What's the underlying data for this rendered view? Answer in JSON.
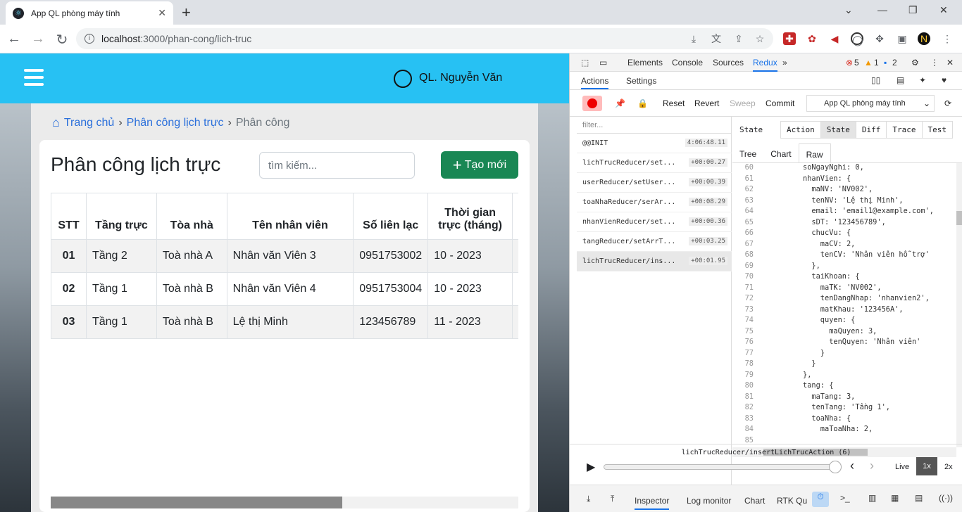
{
  "browser": {
    "tab_title": "App QL phòng máy tính",
    "url_host": "localhost",
    "url_path": ":3000/phan-cong/lich-truc"
  },
  "header": {
    "user_name": "QL. Nguyễn Văn"
  },
  "breadcrumb": {
    "home": "Trang chủ",
    "parent": "Phân công lịch trực",
    "current": "Phân công"
  },
  "page": {
    "title": "Phân công lịch trực",
    "search_placeholder": "tìm kiếm...",
    "new_button": "Tạo mới"
  },
  "table": {
    "headers": [
      "STT",
      "Tầng trực",
      "Tòa nhà",
      "Tên nhân viên",
      "Số liên lạc",
      "Thời gian trực (tháng)"
    ],
    "rows": [
      [
        "01",
        "Tầng 2",
        "Toà nhà A",
        "Nhân văn Viên 3",
        "0951753002",
        "10 - 2023"
      ],
      [
        "02",
        "Tầng 1",
        "Toà nhà B",
        "Nhân văn Viên 4",
        "0951753004",
        "10 - 2023"
      ],
      [
        "03",
        "Tầng 1",
        "Toà nhà B",
        "Lệ thị Minh",
        "123456789",
        "11 - 2023"
      ]
    ]
  },
  "devtools": {
    "tabs": [
      "Elements",
      "Console",
      "Sources",
      "Redux"
    ],
    "errors": "5",
    "warnings": "1",
    "messages": "2",
    "redux_tabs": [
      "Actions",
      "Settings"
    ],
    "buttons": [
      "Reset",
      "Revert",
      "Sweep",
      "Commit"
    ],
    "instance": "App QL phòng máy tính",
    "filter_placeholder": "filter...",
    "actions": [
      {
        "name": "@@INIT",
        "time": "4:06:48.11"
      },
      {
        "name": "lichTrucReducer/set...",
        "time": "+00:00.27"
      },
      {
        "name": "userReducer/setUser...",
        "time": "+00:00.39"
      },
      {
        "name": "toaNhaReducer/serAr...",
        "time": "+00:08.29"
      },
      {
        "name": "nhanVienReducer/set...",
        "time": "+00:00.36"
      },
      {
        "name": "tangReducer/setArrT...",
        "time": "+00:03.25"
      },
      {
        "name": "lichTrucReducer/ins...",
        "time": "+00:01.95"
      }
    ],
    "state_label": "State",
    "view_tabs": [
      "Action",
      "State",
      "Diff",
      "Trace",
      "Test"
    ],
    "sub_tabs": [
      "Tree",
      "Chart",
      "Raw"
    ],
    "current_action": "lichTrucReducer/insertLichTrucAction (6)",
    "speed": [
      "Live",
      "1x",
      "2x"
    ],
    "bottom_tabs": [
      "Inspector",
      "Log monitor",
      "Chart",
      "RTK Qu"
    ]
  },
  "code_lines": [
    {
      "n": "60",
      "t": "          soNgayNghi: 0,"
    },
    {
      "n": "61",
      "t": "          nhanVien: {"
    },
    {
      "n": "62",
      "t": "            maNV: 'NV002',"
    },
    {
      "n": "63",
      "t": "            tenNV: 'Lệ thị Minh',"
    },
    {
      "n": "64",
      "t": "            email: 'email1@example.com',"
    },
    {
      "n": "65",
      "t": "            sDT: '123456789',"
    },
    {
      "n": "66",
      "t": "            chucVu: {"
    },
    {
      "n": "67",
      "t": "              maCV: 2,"
    },
    {
      "n": "68",
      "t": "              tenCV: 'Nhân viên hỗ trợ'"
    },
    {
      "n": "69",
      "t": "            },"
    },
    {
      "n": "70",
      "t": "            taiKhoan: {"
    },
    {
      "n": "71",
      "t": "              maTK: 'NV002',"
    },
    {
      "n": "72",
      "t": "              tenDangNhap: 'nhanvien2',"
    },
    {
      "n": "73",
      "t": "              matKhau: '123456A',"
    },
    {
      "n": "74",
      "t": "              quyen: {"
    },
    {
      "n": "75",
      "t": "                maQuyen: 3,"
    },
    {
      "n": "76",
      "t": "                tenQuyen: 'Nhân viên'"
    },
    {
      "n": "77",
      "t": "              }"
    },
    {
      "n": "78",
      "t": "            }"
    },
    {
      "n": "79",
      "t": "          },"
    },
    {
      "n": "80",
      "t": "          tang: {"
    },
    {
      "n": "81",
      "t": "            maTang: 3,"
    },
    {
      "n": "82",
      "t": "            tenTang: 'Tầng 1',"
    },
    {
      "n": "83",
      "t": "            toaNha: {"
    },
    {
      "n": "84",
      "t": "              maToaNha: 2,"
    },
    {
      "n": "85",
      "t": "              "
    }
  ]
}
